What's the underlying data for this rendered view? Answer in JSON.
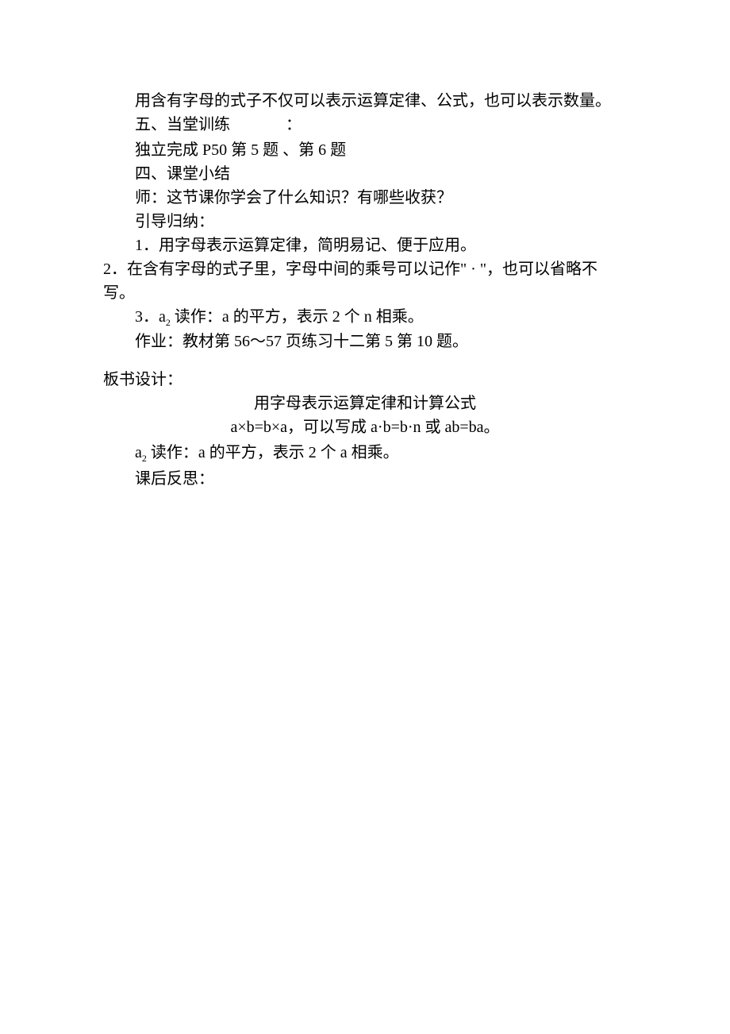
{
  "p1": "用含有字母的式子不仅可以表示运算定律、公式，也可以表示数量。",
  "p2a": "五、当堂训练",
  "p2b": "：",
  "p3": "独立完成 P50 第 5 题 、第 6 题",
  "p4": "四、课堂小结",
  "p5": "师：这节课你学会了什么知识？有哪些收获？",
  "p6": "引导归纳：",
  "p7": "1．用字母表示运算定律，简明易记、便于应用。",
  "p8": "2．在含有字母的式子里，字母中间的乘号可以记作\" · \"，也可以省略不写。",
  "p9a": "3．a",
  "p9sub": "2",
  "p9b": " 读作：a 的平方，表示 2 个 n 相乘。",
  "p10": "作业：教材第 56～57 页练习十二第 5 第 10 题。",
  "p11": "板书设计：",
  "p12": "用字母表示运算定律和计算公式",
  "p13": "a×b=b×a，可以写成 a·b=b·n 或 ab=ba。",
  "p14a": "a",
  "p14sub": "2",
  "p14b": " 读作：a 的平方，表示 2 个 a 相乘。",
  "p15": "课后反思："
}
